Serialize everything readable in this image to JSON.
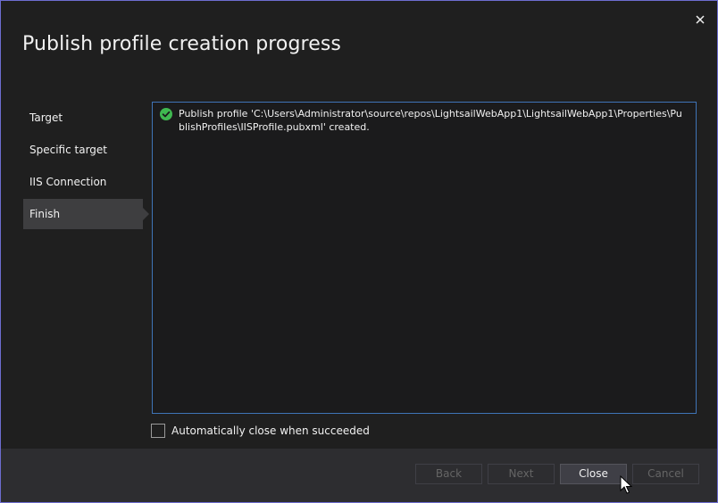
{
  "dialog": {
    "title": "Publish profile creation progress",
    "close_icon": "close-icon"
  },
  "nav": {
    "items": [
      {
        "label": "Target",
        "selected": false
      },
      {
        "label": "Specific target",
        "selected": false
      },
      {
        "label": "IIS Connection",
        "selected": false
      },
      {
        "label": "Finish",
        "selected": true
      }
    ]
  },
  "log": {
    "entries": [
      {
        "icon": "success-check-icon",
        "text": "Publish profile 'C:\\Users\\Administrator\\source\\repos\\LightsailWebApp1\\LightsailWebApp1\\Properties\\PublishProfiles\\IISProfile.pubxml' created."
      }
    ]
  },
  "options": {
    "auto_close_label": "Automatically close when succeeded",
    "auto_close_checked": false
  },
  "buttons": {
    "back": "Back",
    "next": "Next",
    "close": "Close",
    "cancel": "Cancel"
  },
  "colors": {
    "accent_border": "#3f74b7",
    "success": "#3fb950",
    "window_border": "#6d6dd0"
  }
}
